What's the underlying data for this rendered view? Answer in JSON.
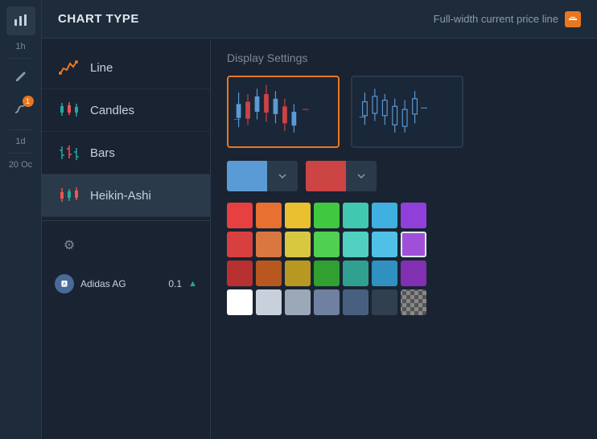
{
  "header": {
    "title": "CHART TYPE",
    "price_line_label": "Full-width current price line"
  },
  "chart_types": [
    {
      "id": "line",
      "label": "Line"
    },
    {
      "id": "candles",
      "label": "Candles"
    },
    {
      "id": "bars",
      "label": "Bars"
    },
    {
      "id": "heikin-ashi",
      "label": "Heikin-Ashi"
    }
  ],
  "display_settings": {
    "title": "Display Settings"
  },
  "colors": {
    "swatch1": "#5b9bd5",
    "swatch2": "#cc4444",
    "grid": [
      "#e84040",
      "#e87030",
      "#e8c030",
      "#40c840",
      "#40c8b0",
      "#40b0e0",
      "#9040d8",
      "#d84040",
      "#d87840",
      "#d8c840",
      "#50d050",
      "#50d0c0",
      "#50c0e8",
      "#a050d8",
      "#b83030",
      "#b85820",
      "#b89820",
      "#30a030",
      "#30a090",
      "#3090c0",
      "#8030b0",
      "#ffffff",
      "#c8d0dc",
      "#9aa8b8",
      "#7080a0",
      "#486080",
      "#304050",
      "checker"
    ]
  },
  "sidebar": {
    "time_labels": [
      "1h",
      "1d"
    ],
    "date_label": "20 Oc"
  },
  "bottom": {
    "company": "Adidas AG",
    "price": "0.1"
  },
  "selected_color_index": 13
}
